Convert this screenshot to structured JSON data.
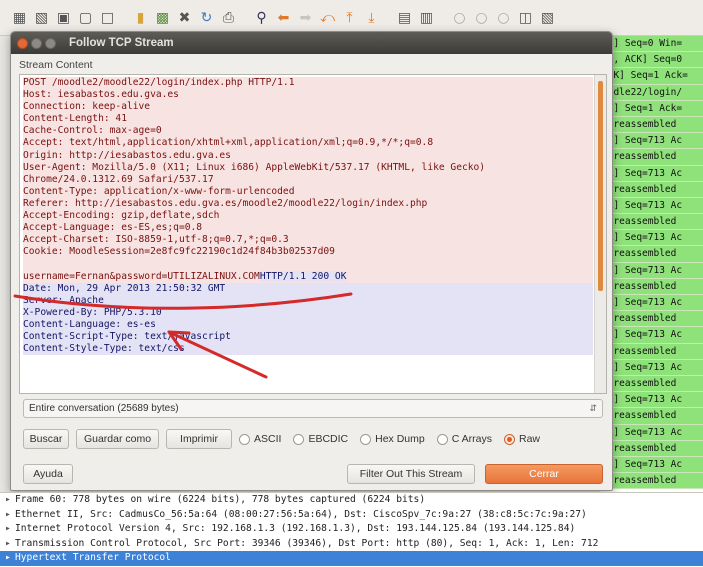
{
  "toolbar": {
    "icons": [
      "open-file-icon",
      "save-icon",
      "capture-icon",
      "stop-icon",
      "restart-icon",
      "folder-icon",
      "save-file-icon",
      "close-file-icon",
      "reload-icon",
      "print-icon",
      "find-icon",
      "back-icon",
      "forward-icon",
      "jump-icon",
      "top-icon",
      "bottom-icon",
      "colorize-icon",
      "autoscroll-icon",
      "zoom-in-icon",
      "zoom-out-icon",
      "zoom-normal-icon",
      "resize-columns-icon",
      "filter-icon"
    ]
  },
  "packet_list": {
    "rows": [
      "YN] Seq=0 Win=",
      "YN, ACK] Seq=0",
      "ACK] Seq=1 Ack=",
      "oodle22/login/",
      "CK] Seq=1 Ack=",
      " a reassembled",
      "CK] Seq=713 Ac",
      " a reassembled",
      "CK] Seq=713 Ac",
      " a reassembled",
      "CK] Seq=713 Ac",
      " a reassembled",
      "CK] Seq=713 Ac",
      " a reassembled",
      "CK] Seq=713 Ac",
      " a reassembled",
      "CK] Seq=713 Ac",
      " a reassembled",
      "CK] Seq=713 Ac",
      " a reassembled",
      "CK] Seq=713 Ac",
      " a reassembled",
      "CK] Seq=713 Ac",
      " a reassembled",
      "CK] Seq=713 Ac",
      " a reassembled",
      "CK] Seq=713 Ac",
      " a reassembled"
    ]
  },
  "dialog": {
    "title": "Follow TCP Stream",
    "stream_label": "Stream Content",
    "stream_lines": [
      {
        "text": "POST /moodle2/moodle22/login/index.php HTTP/1.1",
        "kind": "req"
      },
      {
        "text": "Host: iesabastos.edu.gva.es",
        "kind": "req"
      },
      {
        "text": "Connection: keep-alive",
        "kind": "req"
      },
      {
        "text": "Content-Length: 41",
        "kind": "req"
      },
      {
        "text": "Cache-Control: max-age=0",
        "kind": "req"
      },
      {
        "text": "Accept: text/html,application/xhtml+xml,application/xml;q=0.9,*/*;q=0.8",
        "kind": "req"
      },
      {
        "text": "Origin: http://iesabastos.edu.gva.es",
        "kind": "req"
      },
      {
        "text": "User-Agent: Mozilla/5.0 (X11; Linux i686) AppleWebKit/537.17 (KHTML, like Gecko)",
        "kind": "req"
      },
      {
        "text": "Chrome/24.0.1312.69 Safari/537.17",
        "kind": "req"
      },
      {
        "text": "Content-Type: application/x-www-form-urlencoded",
        "kind": "req"
      },
      {
        "text": "Referer: http://iesabastos.edu.gva.es/moodle2/moodle22/login/index.php",
        "kind": "req"
      },
      {
        "text": "Accept-Encoding: gzip,deflate,sdch",
        "kind": "req"
      },
      {
        "text": "Accept-Language: es-ES,es;q=0.8",
        "kind": "req"
      },
      {
        "text": "Accept-Charset: ISO-8859-1,utf-8;q=0.7,*;q=0.3",
        "kind": "req"
      },
      {
        "text": "Cookie: MoodleSession=2e8fc9fc22190c1d24f84b3b02537d09",
        "kind": "req"
      },
      {
        "text": "",
        "kind": "blank"
      },
      {
        "text": "username=Fernan&password=UTILIZALINUX.COM",
        "kind": "req"
      },
      {
        "text": "Date: Mon, 29 Apr 2013 21:50:32 GMT",
        "kind": "resp"
      },
      {
        "text": "Server: Apache",
        "kind": "resp"
      },
      {
        "text": "X-Powered-By: PHP/5.3.10",
        "kind": "resp"
      },
      {
        "text": "Content-Language: es-es",
        "kind": "resp"
      },
      {
        "text": "Content-Script-Type: text/javascript",
        "kind": "resp"
      },
      {
        "text": "Content-Style-Type: text/css",
        "kind": "resp"
      }
    ],
    "response_status": "HTTP/1.1 200 OK",
    "conversation_select": "Entire conversation (25689 bytes)",
    "buttons": {
      "find": "Buscar",
      "save_as": "Guardar como",
      "print": "Imprimir",
      "help": "Ayuda",
      "filter_out": "Filter Out This Stream",
      "close": "Cerrar"
    },
    "formats": [
      {
        "label": "ASCII",
        "selected": false
      },
      {
        "label": "EBCDIC",
        "selected": false
      },
      {
        "label": "Hex Dump",
        "selected": false
      },
      {
        "label": "C Arrays",
        "selected": false
      },
      {
        "label": "Raw",
        "selected": true
      }
    ],
    "accent_color": "#e8743a"
  },
  "details": {
    "lines": [
      {
        "text": "Frame 60: 778 bytes on wire (6224 bits), 778 bytes captured (6224 bits)",
        "selected": false
      },
      {
        "text": "Ethernet II, Src: CadmusCo_56:5a:64 (08:00:27:56:5a:64), Dst: CiscoSpv_7c:9a:27 (38:c8:5c:7c:9a:27)",
        "selected": false
      },
      {
        "text": "Internet Protocol Version 4, Src: 192.168.1.3 (192.168.1.3), Dst: 193.144.125.84 (193.144.125.84)",
        "selected": false
      },
      {
        "text": "Transmission Control Protocol, Src Port: 39346 (39346), Dst Port: http (80), Seq: 1, Ack: 1, Len: 712",
        "selected": false
      },
      {
        "text": "Hypertext Transfer Protocol",
        "selected": true
      }
    ]
  }
}
